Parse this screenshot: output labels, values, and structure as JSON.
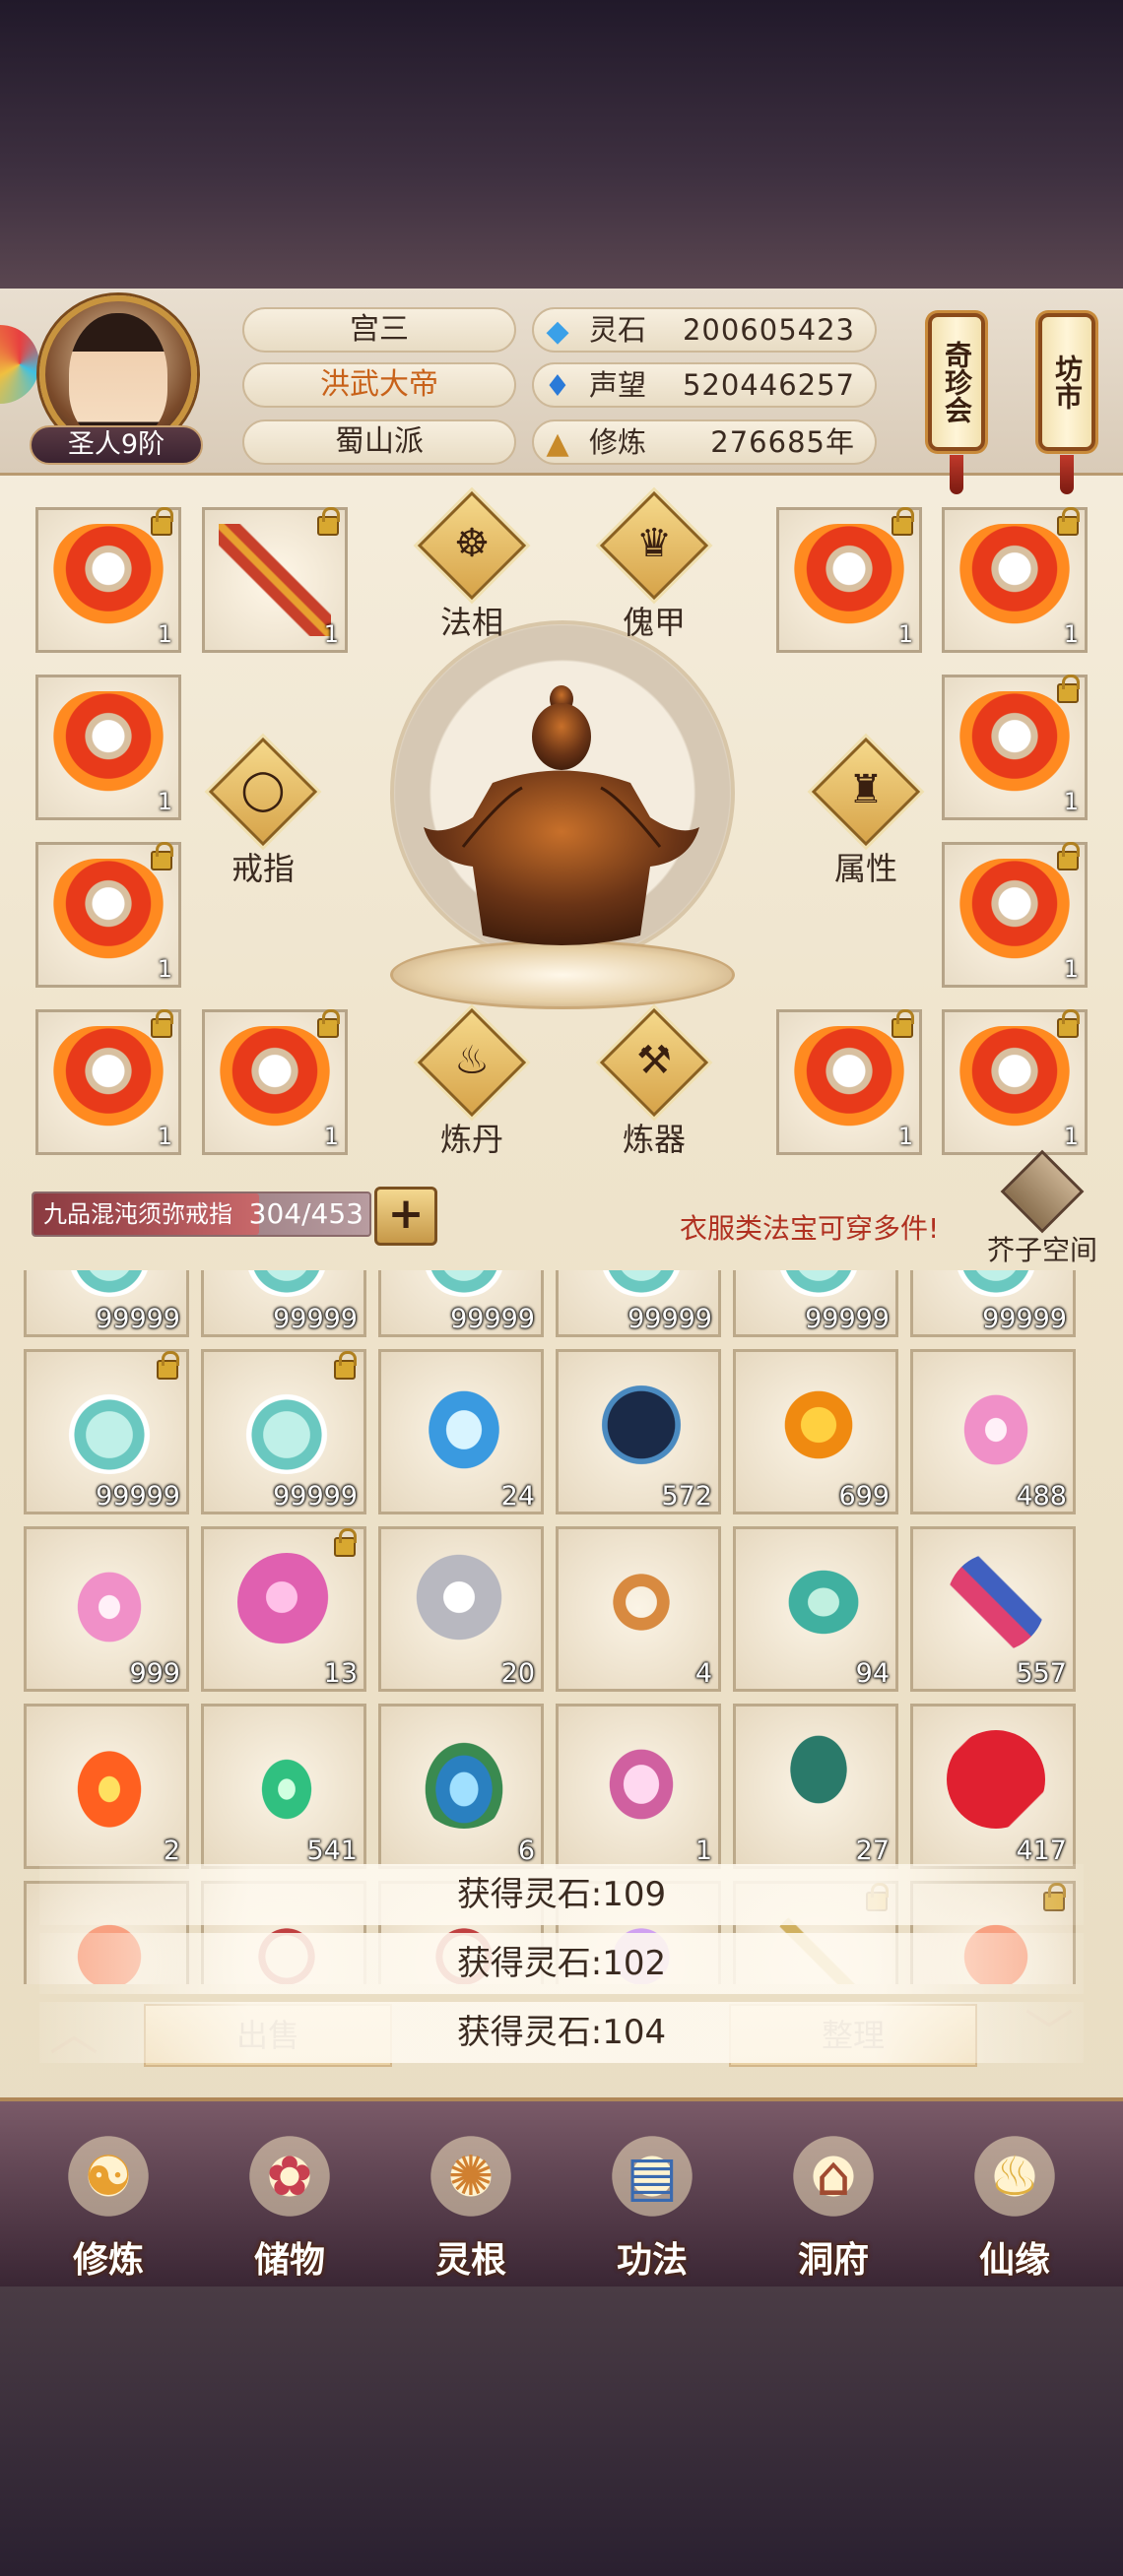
{
  "player": {
    "rank": "圣人9阶",
    "name": "宫三",
    "title": "洪武大帝",
    "sect": "蜀山派"
  },
  "stats": [
    {
      "icon": "spirit-stone-icon",
      "label": "灵石",
      "value": "200605423"
    },
    {
      "icon": "reputation-icon",
      "label": "声望",
      "value": "520446257"
    },
    {
      "icon": "cultivation-icon",
      "label": "修炼",
      "value": "276685年"
    }
  ],
  "side_buttons": {
    "treasure_shop": "奇珍会",
    "market": "坊市"
  },
  "feature_buttons": {
    "dharma_form": "法相",
    "puppet_armor": "傀甲",
    "ring": "戒指",
    "attributes": "属性",
    "alchemy": "炼丹",
    "forging": "炼器"
  },
  "equipment_slots": [
    {
      "count": "1",
      "locked": true,
      "art": "robe"
    },
    {
      "count": "1",
      "locked": true,
      "art": "bow"
    },
    {
      "count": "1",
      "locked": true,
      "art": "robe"
    },
    {
      "count": "1",
      "locked": true,
      "art": "robe"
    },
    {
      "count": "1",
      "locked": false,
      "art": "robe"
    },
    {
      "count": "1",
      "locked": true,
      "art": "robe"
    },
    {
      "count": "1",
      "locked": true,
      "art": "robe"
    },
    {
      "count": "1",
      "locked": true,
      "art": "robe"
    },
    {
      "count": "1",
      "locked": true,
      "art": "robe"
    },
    {
      "count": "1",
      "locked": true,
      "art": "robe"
    },
    {
      "count": "1",
      "locked": true,
      "art": "robe"
    },
    {
      "count": "1",
      "locked": true,
      "art": "robe"
    }
  ],
  "storage": {
    "ring_name": "九品混沌须弥戒指",
    "capacity": "304/453",
    "capacity_fraction": 0.671,
    "expand_label": "+",
    "hint": "衣服类法宝可穿多件!",
    "space_label": "芥子空间"
  },
  "inventory": [
    {
      "count": "99999",
      "locked": false,
      "art": "gourd"
    },
    {
      "count": "99999",
      "locked": false,
      "art": "gourd"
    },
    {
      "count": "99999",
      "locked": false,
      "art": "gourd"
    },
    {
      "count": "99999",
      "locked": false,
      "art": "gourd"
    },
    {
      "count": "99999",
      "locked": false,
      "art": "gourd"
    },
    {
      "count": "99999",
      "locked": false,
      "art": "gourd"
    },
    {
      "count": "99999",
      "locked": true,
      "art": "gourd"
    },
    {
      "count": "99999",
      "locked": true,
      "art": "gourd"
    },
    {
      "count": "24",
      "locked": false,
      "art": "tea-bowl"
    },
    {
      "count": "572",
      "locked": false,
      "art": "star-disc"
    },
    {
      "count": "699",
      "locked": false,
      "art": "amber-gem"
    },
    {
      "count": "488",
      "locked": false,
      "art": "lotus"
    },
    {
      "count": "999",
      "locked": false,
      "art": "lotus"
    },
    {
      "count": "13",
      "locked": true,
      "art": "pink-egg"
    },
    {
      "count": "20",
      "locked": false,
      "art": "silver-orb"
    },
    {
      "count": "4",
      "locked": false,
      "art": "ring"
    },
    {
      "count": "94",
      "locked": false,
      "art": "jade-gourd"
    },
    {
      "count": "557",
      "locked": false,
      "art": "scroll"
    },
    {
      "count": "2",
      "locked": false,
      "art": "fire"
    },
    {
      "count": "541",
      "locked": false,
      "art": "green-flame"
    },
    {
      "count": "6",
      "locked": false,
      "art": "water-leaf"
    },
    {
      "count": "1",
      "locked": false,
      "art": "teacup"
    },
    {
      "count": "27",
      "locked": false,
      "art": "tree"
    },
    {
      "count": "417",
      "locked": false,
      "art": "red-crystal"
    },
    {
      "count": "",
      "locked": false,
      "art": "peach"
    },
    {
      "count": "",
      "locked": false,
      "art": "vase"
    },
    {
      "count": "",
      "locked": false,
      "art": "vase"
    },
    {
      "count": "",
      "locked": false,
      "art": "purple"
    },
    {
      "count": "",
      "locked": true,
      "art": "sword"
    },
    {
      "count": "",
      "locked": true,
      "art": "peach"
    }
  ],
  "actions": {
    "sell": "出售",
    "organize": "整理"
  },
  "toasts": [
    "获得灵石:109",
    "获得灵石:102",
    "获得灵石:104"
  ],
  "nav": [
    {
      "label": "修炼",
      "icon": "meditating-monk-icon"
    },
    {
      "label": "储物",
      "icon": "treasure-bag-icon"
    },
    {
      "label": "灵根",
      "icon": "spirit-root-icon"
    },
    {
      "label": "功法",
      "icon": "technique-book-icon"
    },
    {
      "label": "洞府",
      "icon": "cave-dwelling-icon"
    },
    {
      "label": "仙缘",
      "icon": "fortune-gourd-icon"
    }
  ],
  "colors": {
    "title_highlight": "#c8621a",
    "hint_red": "#b03020",
    "accent_gold": "#c8943e"
  }
}
